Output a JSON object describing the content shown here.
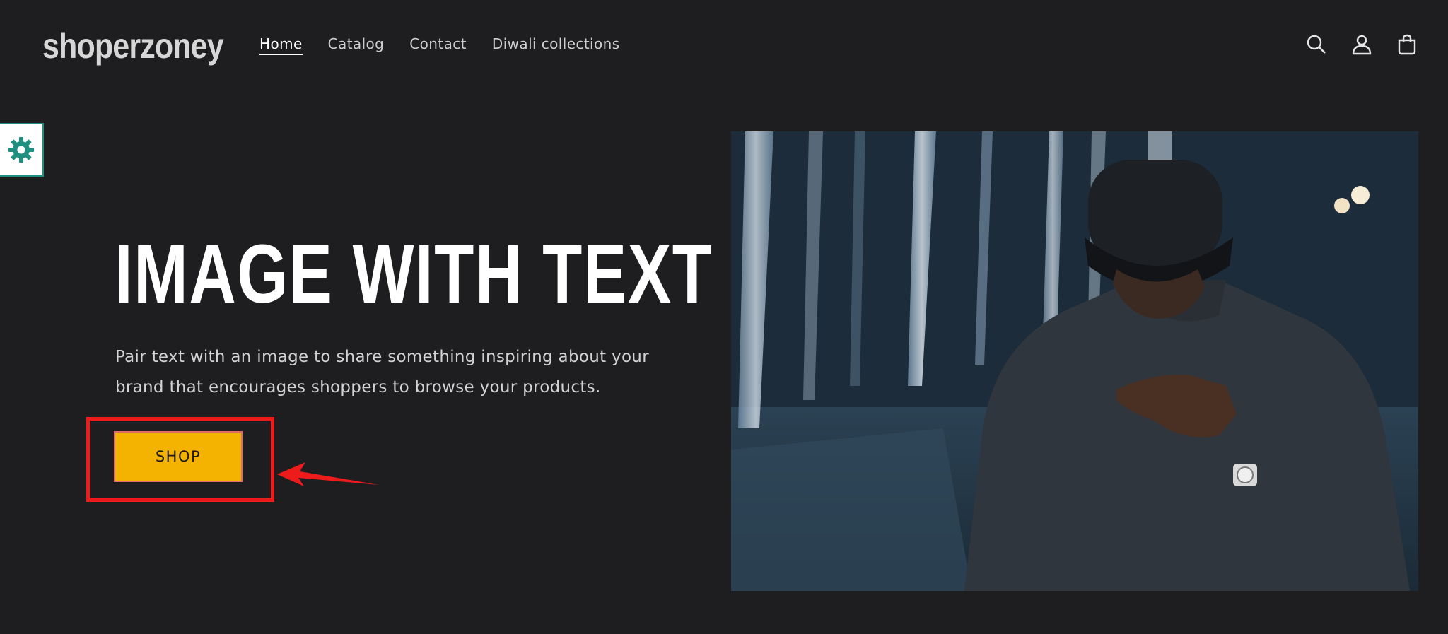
{
  "header": {
    "logo": "shoperzoney",
    "nav": [
      {
        "label": "Home",
        "active": true
      },
      {
        "label": "Catalog",
        "active": false
      },
      {
        "label": "Contact",
        "active": false
      },
      {
        "label": "Diwali collections",
        "active": false
      }
    ],
    "icons": [
      "search-icon",
      "account-icon",
      "cart-icon"
    ]
  },
  "settings_tab": {
    "icon": "gear-icon",
    "color": "#1f8f7f"
  },
  "hero": {
    "title": "IMAGE WITH TEXT",
    "text_line1": "Pair text with an image to share something inspiring about your",
    "text_line2": "brand that encourages shoppers to browse your products.",
    "button_label": "SHOP",
    "button_color": "#f5b301",
    "image_alt": "man-in-cap-and-dotted-shirt"
  },
  "annotation": {
    "highlight_color": "#ee1b1b"
  }
}
